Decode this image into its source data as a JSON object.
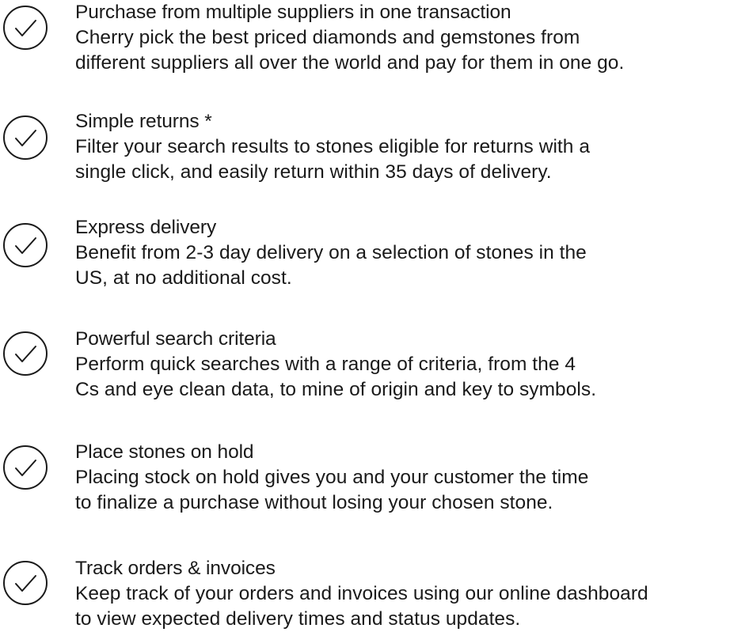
{
  "features": [
    {
      "icon": "check-circle-icon",
      "title": "Purchase from multiple suppliers in one transaction",
      "lines": [
        "Cherry pick the best priced diamonds and gemstones from",
        "different suppliers all over the world and pay for them in one go."
      ]
    },
    {
      "icon": "check-circle-icon",
      "title": "Simple returns *",
      "lines": [
        "Filter your search results to stones eligible for returns with a",
        "single click, and easily return within 35 days of delivery."
      ]
    },
    {
      "icon": "check-circle-icon",
      "title": "Express delivery",
      "lines": [
        "Benefit from 2-3 day delivery on a selection of stones in the",
        "US, at no additional cost."
      ]
    },
    {
      "icon": "check-circle-icon",
      "title": "Powerful search criteria",
      "lines": [
        "Perform quick searches with a range of criteria, from the 4",
        "Cs and eye clean data, to mine of origin and key to symbols."
      ]
    },
    {
      "icon": "check-circle-icon",
      "title": "Place stones on hold",
      "lines": [
        "Placing stock on hold gives you and your customer the time",
        "to finalize a purchase without losing your chosen stone."
      ]
    },
    {
      "icon": "check-circle-icon",
      "title": "Track orders & invoices",
      "lines": [
        "Keep track of your orders and invoices using our online dashboard",
        "to view expected delivery times and status updates."
      ]
    }
  ]
}
